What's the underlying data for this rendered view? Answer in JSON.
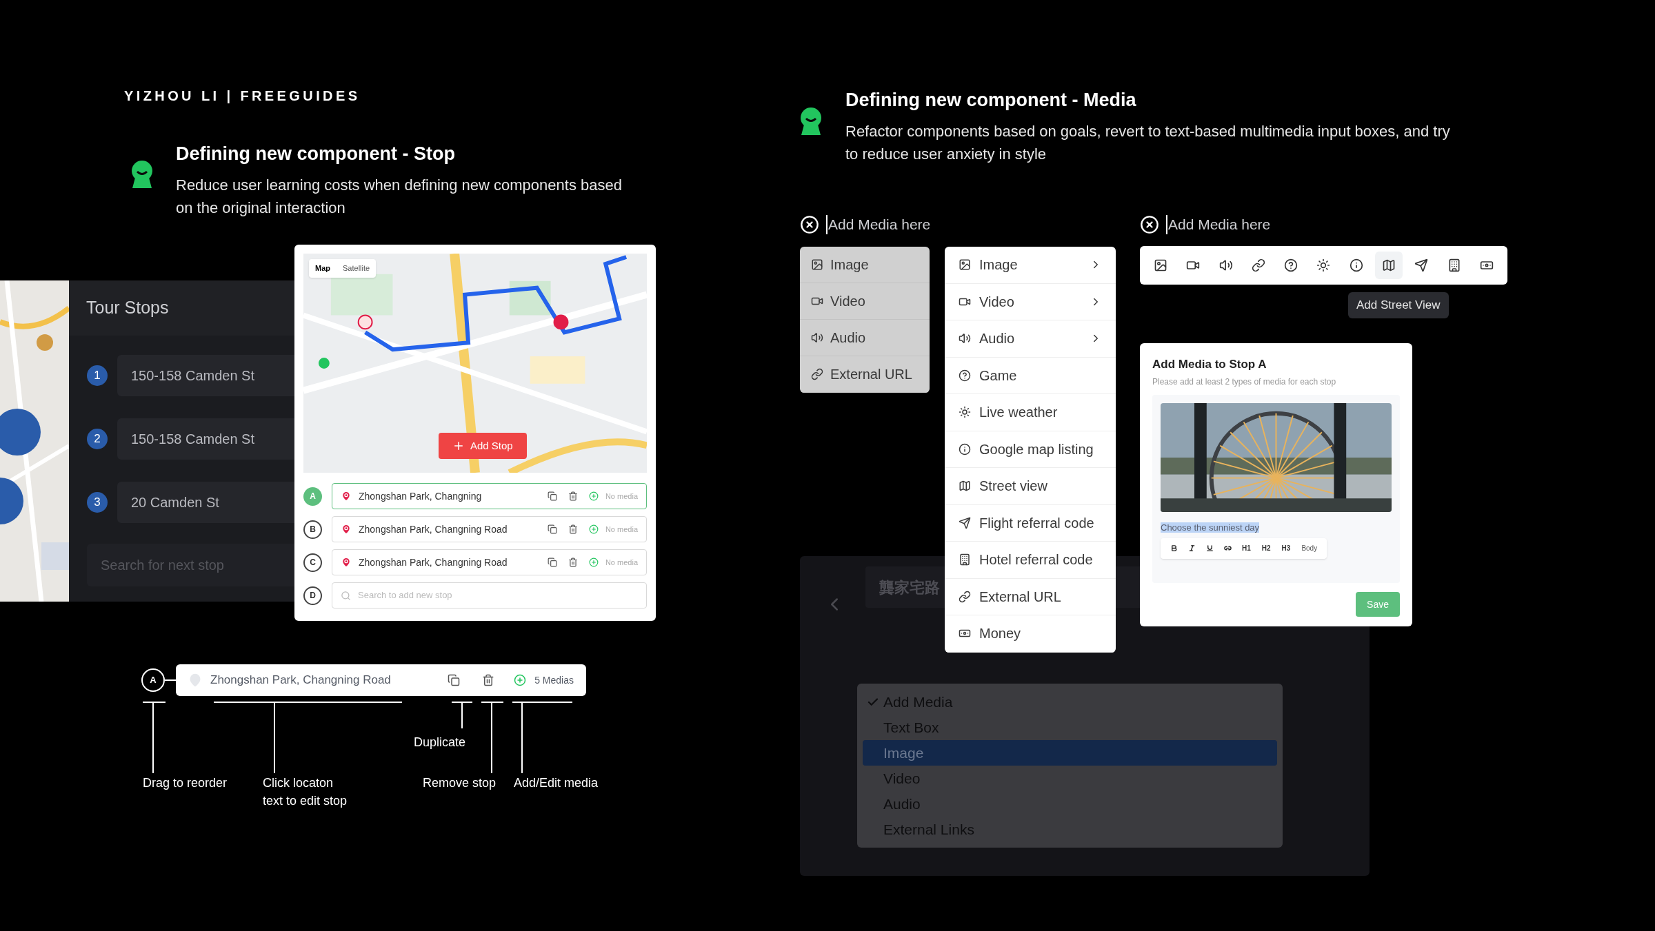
{
  "brand": "YIZHOU LI | FREEGUIDES",
  "stop_section": {
    "title": "Defining new component - Stop",
    "description": "Reduce user learning costs when defining new components based on the original interaction"
  },
  "media_section": {
    "title": "Defining new component - Media",
    "description": "Refactor components based on goals, revert to text-based multimedia input boxes, and try to reduce user anxiety in style"
  },
  "tour_stops": {
    "title": "Tour Stops",
    "stops": [
      {
        "number": "1",
        "address": "150-158 Camden St"
      },
      {
        "number": "2",
        "address": "150-158 Camden St"
      },
      {
        "number": "3",
        "address": "20 Camden St"
      }
    ],
    "search_placeholder": "Search for next stop"
  },
  "stop_editor": {
    "map_tabs": [
      {
        "label": "Map",
        "selected": true
      },
      {
        "label": "Satellite",
        "selected": false
      }
    ],
    "add_stop": "Add Stop",
    "stops": [
      {
        "letter": "A",
        "location": "Zhongshan Park, Changning",
        "media": "No media",
        "selected": true
      },
      {
        "letter": "B",
        "location": "Zhongshan Park, Changning Road",
        "media": "No media",
        "selected": false
      },
      {
        "letter": "C",
        "location": "Zhongshan Park, Changning Road",
        "media": "No media",
        "selected": false
      }
    ],
    "new_stop": {
      "letter": "D",
      "placeholder": "Search to add new stop"
    }
  },
  "anatomy": {
    "letter": "A",
    "location": "Zhongshan Park, Changning Road",
    "media": "5 Medias",
    "annotations": [
      "Drag to reorder",
      "Click locaton\ntext to edit stop",
      "Duplicate",
      "Remove stop",
      "Add/Edit media"
    ]
  },
  "media_picker_a": {
    "placeholder": "Add Media here",
    "menu": [
      {
        "label": "Image"
      },
      {
        "label": "Video"
      },
      {
        "label": "Audio"
      },
      {
        "label": "External URL"
      }
    ],
    "submenu": [
      {
        "label": "Image",
        "has_submenu": true
      },
      {
        "label": "Video",
        "has_submenu": true
      },
      {
        "label": "Audio",
        "has_submenu": true
      },
      {
        "label": "Game",
        "has_submenu": false
      },
      {
        "label": "Live weather",
        "has_submenu": false
      },
      {
        "label": "Google map listing",
        "has_submenu": false
      },
      {
        "label": "Street view",
        "has_submenu": false
      },
      {
        "label": "Flight referral code",
        "has_submenu": false
      },
      {
        "label": "Hotel referral code",
        "has_submenu": false
      },
      {
        "label": "External URL",
        "has_submenu": false
      },
      {
        "label": "Money",
        "has_submenu": false
      }
    ]
  },
  "media_picker_b": {
    "placeholder": "Add Media here",
    "tools": [
      {
        "selected": false
      },
      {
        "selected": false
      },
      {
        "selected": false
      },
      {
        "selected": false
      },
      {
        "selected": false
      },
      {
        "selected": false
      },
      {
        "selected": false
      },
      {
        "selected": true
      },
      {
        "selected": false
      },
      {
        "selected": false
      },
      {
        "selected": false
      }
    ],
    "tooltip": "Add Street View"
  },
  "dialog": {
    "title": "Add Media to Stop A",
    "subtitle": "Please add at least 2 types of media for each stop",
    "caption": "Choose the sunniest day",
    "format_tools": [
      {
        "kind": "bold"
      },
      {
        "kind": "italic"
      },
      {
        "kind": "underline"
      },
      {
        "kind": "link"
      },
      {
        "kind": "text",
        "label": "H1"
      },
      {
        "kind": "text",
        "label": "H2"
      },
      {
        "kind": "text",
        "label": "H3"
      },
      {
        "kind": "text",
        "label": "Body"
      }
    ],
    "save": "Save"
  },
  "native_menu": {
    "background_text": "龔家宅路",
    "items": [
      {
        "label": "Add Media",
        "checked": true,
        "selected": false
      },
      {
        "label": "Text Box",
        "checked": false,
        "selected": false
      },
      {
        "label": "Image",
        "checked": false,
        "selected": true
      },
      {
        "label": "Video",
        "checked": false,
        "selected": false
      },
      {
        "label": "Audio",
        "checked": false,
        "selected": false
      },
      {
        "label": "External Links",
        "checked": false,
        "selected": false
      }
    ]
  }
}
